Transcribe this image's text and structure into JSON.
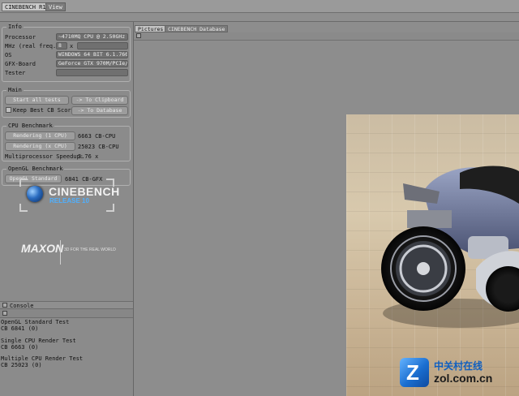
{
  "menubar": {
    "app_tab": "CINEBENCH R10",
    "view_tab": "View"
  },
  "info": {
    "title": "Info",
    "processor_label": "Processor",
    "processor_value": "~4710MQ CPU @ 2.50GHz",
    "mhz_label": "MHz (real freq.)",
    "mhz_value": "8",
    "mhz_x": "x",
    "os_label": "OS",
    "os_value": "WINDOWS 64 BIT 6.1.760",
    "gfx_label": "GFX-Board",
    "gfx_value": "GeForce GTX 970M/PCIe/",
    "tester_label": "Tester",
    "tester_value": ""
  },
  "main": {
    "title": "Main",
    "start_all_tests": "Start all tests",
    "to_clipboard": "-> To Clipboard",
    "keep_best_label": "Keep Best CB Score",
    "to_database": "-> To Database"
  },
  "cpu": {
    "title": "CPU Benchmark",
    "render1_button": "Rendering (1 CPU)",
    "render1_result": "6663 CB-CPU",
    "renderx_button": "Rendering (x CPU)",
    "renderx_result": "25023 CB-CPU",
    "speedup_label": "Multiprocessor Speedup:",
    "speedup_value": "3.76 x"
  },
  "opengl": {
    "title": "OpenGL Benchmark",
    "button": "OpenGL Standard",
    "result": "6841 CB-GFX"
  },
  "logo": {
    "name": "CINEBENCH",
    "release": "RELEASE 10"
  },
  "maxon": {
    "name": "MAXON",
    "tagline": "3D FOR THE REAL WORLD"
  },
  "console": {
    "title": "Console",
    "lines": [
      "OpenGL Standard Test",
      "CB 6841 (0)",
      "",
      "Single CPU Render Test",
      "CB 6663 (0)",
      "",
      "Multiple CPU Render Test",
      "CB 25023 (0)"
    ]
  },
  "right": {
    "tab_pictures": "Pictures",
    "tab_database": "CINEBENCH Database"
  },
  "watermark": {
    "cn": "中关村在线",
    "site": "zol.com.cn",
    "letter": "Z"
  },
  "colors": {
    "panel_bg": "#8b8b8b",
    "logo_blue": "#4fb0ff",
    "wm_blue": "#0f5fc0"
  }
}
